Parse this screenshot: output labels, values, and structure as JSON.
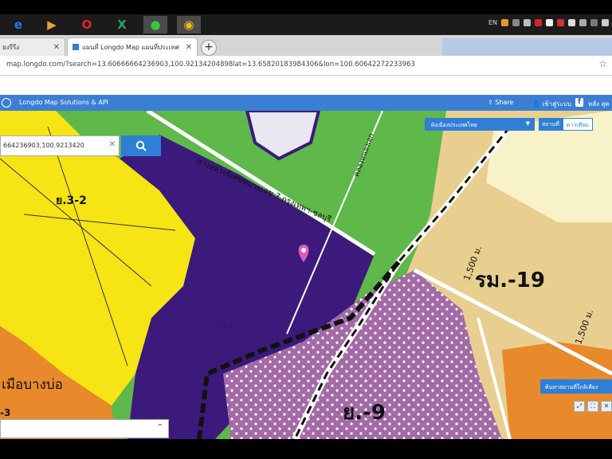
{
  "taskbar": {
    "apps": [
      {
        "name": "internet-explorer",
        "glyph": "e",
        "color": "#1e7fd8"
      },
      {
        "name": "media-player",
        "glyph": "▶",
        "color": "#e8a23a"
      },
      {
        "name": "opera",
        "glyph": "O",
        "color": "#e0262c"
      },
      {
        "name": "excel",
        "glyph": "X",
        "color": "#1f7a3d"
      },
      {
        "name": "line",
        "glyph": "●",
        "color": "#37c637"
      },
      {
        "name": "chrome",
        "glyph": "◉",
        "color": "#f2b91a"
      }
    ],
    "tray_lang": "EN"
  },
  "browser": {
    "tabs": [
      {
        "label": "ยงรีรีง"
      },
      {
        "label": "แผนที่ Longdo Map แผนที่ประเทศ"
      }
    ],
    "url": "map.longdo.com/?search=13.60666664236903,100.92134204898lat=13.65820183984306&lon=100.60642272233963"
  },
  "app": {
    "logo_text": "Longdo Map Solutions & API",
    "share_label": "Share",
    "login_label": "เข้าสู่ระบบ",
    "more_label": "หลัง สุด"
  },
  "search": {
    "value": "664236903,100.9213420"
  },
  "controls": {
    "layer_select": "ผังเมืองประเทศไทย",
    "map_types": [
      "สถานที่",
      "ดาวเทียม"
    ],
    "poi_button": "ค้นหาสถานที่ใกล้เคียง"
  },
  "map_labels": {
    "zone_y3_2": "ย.3-2",
    "zone_ror_mo_19": "รม.-19",
    "zone_y9": "ย.-9",
    "district": "เมือบางบ่อ",
    "dist_a": "1,500 ม.",
    "dist_b": "1,500 ม.",
    "road": "ทางหลวงพิเศษหมายเลข 7 กรุงเทพฯ-ชลบุรี",
    "canal": "คลองหนองเอก",
    "zone_y3": "-3",
    "dark_zone": "ก.1"
  },
  "colors": {
    "yellow_zone": "#f6e414",
    "purple_zone": "#3b1a7c",
    "green_zone": "#5eb84a",
    "pink_zone": "#a36aa6",
    "orange_zone": "#e8892b",
    "beige_zone": "#e8cf8f",
    "accent": "#2f7fd7"
  }
}
